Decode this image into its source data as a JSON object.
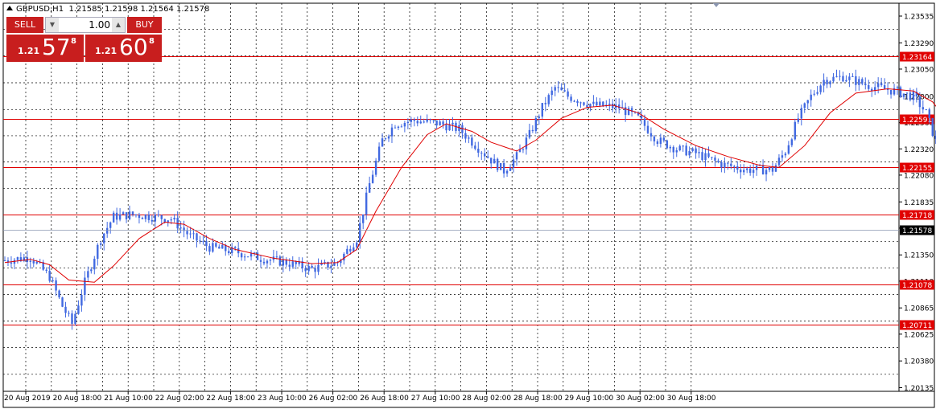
{
  "header": {
    "symbol": "GBPUSD,H1",
    "ohlc": "1.21585 1.21598 1.21564 1.21578"
  },
  "trade_panel": {
    "sell_label": "SELL",
    "buy_label": "BUY",
    "lot_value": "1.00",
    "sell_prefix": "1.21",
    "sell_big": "57",
    "sell_sup": "8",
    "buy_prefix": "1.21",
    "buy_big": "60",
    "buy_sup": "8"
  },
  "colors": {
    "background": "#ffffff",
    "candle": "#4169e1",
    "moving_average": "#e00000",
    "level_line": "#e00000",
    "level_label_bg": "#e00000",
    "current_price_bg": "#000000",
    "grid": "#000000",
    "panel_red": "#c81e1e"
  },
  "chart_data": {
    "type": "candlestick",
    "symbol": "GBPUSD",
    "timeframe": "H1",
    "y_axis": {
      "min": 1.20135,
      "max": 1.23535,
      "ticks": [
        "1.23535",
        "1.23290",
        "1.23050",
        "1.22800",
        "1.22560",
        "1.22320",
        "1.22080",
        "1.21835",
        "1.21595",
        "1.21350",
        "1.21110",
        "1.20865",
        "1.20625",
        "1.20380",
        "1.20135"
      ]
    },
    "x_axis": {
      "ticks": [
        "20 Aug 2019",
        "20 Aug 18:00",
        "21 Aug 10:00",
        "22 Aug 02:00",
        "22 Aug 18:00",
        "23 Aug 10:00",
        "26 Aug 02:00",
        "26 Aug 18:00",
        "27 Aug 10:00",
        "28 Aug 02:00",
        "28 Aug 18:00",
        "29 Aug 10:00",
        "30 Aug 02:00",
        "30 Aug 18:00"
      ]
    },
    "levels": [
      "1.23164",
      "1.22591",
      "1.22155",
      "1.21718",
      "1.21078",
      "1.20711"
    ],
    "current_price": "1.21578",
    "bars_per_grid": 16,
    "close_path": [
      [
        0,
        1.213
      ],
      [
        8,
        1.2133
      ],
      [
        14,
        1.2115
      ],
      [
        18,
        1.2088
      ],
      [
        21,
        1.2072
      ],
      [
        25,
        1.211
      ],
      [
        30,
        1.215
      ],
      [
        34,
        1.217
      ],
      [
        40,
        1.2172
      ],
      [
        46,
        1.217
      ],
      [
        52,
        1.2168
      ],
      [
        58,
        1.2152
      ],
      [
        64,
        1.2142
      ],
      [
        72,
        1.2138
      ],
      [
        80,
        1.2132
      ],
      [
        88,
        1.2128
      ],
      [
        96,
        1.2122
      ],
      [
        104,
        1.2128
      ],
      [
        110,
        1.215
      ],
      [
        114,
        1.22
      ],
      [
        118,
        1.224
      ],
      [
        122,
        1.2255
      ],
      [
        128,
        1.2258
      ],
      [
        136,
        1.2255
      ],
      [
        142,
        1.225
      ],
      [
        148,
        1.2233
      ],
      [
        152,
        1.2222
      ],
      [
        156,
        1.2212
      ],
      [
        160,
        1.2225
      ],
      [
        164,
        1.2245
      ],
      [
        168,
        1.227
      ],
      [
        172,
        1.2288
      ],
      [
        176,
        1.228
      ],
      [
        184,
        1.2272
      ],
      [
        192,
        1.227
      ],
      [
        198,
        1.226
      ],
      [
        204,
        1.224
      ],
      [
        210,
        1.2232
      ],
      [
        216,
        1.2228
      ],
      [
        224,
        1.2218
      ],
      [
        232,
        1.2213
      ],
      [
        240,
        1.2213
      ],
      [
        244,
        1.223
      ],
      [
        248,
        1.226
      ],
      [
        252,
        1.228
      ],
      [
        256,
        1.2295
      ],
      [
        262,
        1.2298
      ],
      [
        270,
        1.229
      ],
      [
        278,
        1.2285
      ],
      [
        284,
        1.228
      ],
      [
        288,
        1.2265
      ],
      [
        292,
        1.223
      ],
      [
        296,
        1.2212
      ],
      [
        300,
        1.2208
      ],
      [
        306,
        1.2228
      ],
      [
        312,
        1.2222
      ],
      [
        318,
        1.2218
      ],
      [
        324,
        1.221
      ],
      [
        332,
        1.2205
      ],
      [
        340,
        1.2198
      ],
      [
        348,
        1.2195
      ],
      [
        356,
        1.2188
      ],
      [
        364,
        1.2185
      ],
      [
        372,
        1.2182
      ],
      [
        380,
        1.218
      ],
      [
        384,
        1.2196
      ],
      [
        388,
        1.219
      ],
      [
        392,
        1.2178
      ],
      [
        398,
        1.2168
      ],
      [
        404,
        1.2163
      ],
      [
        410,
        1.216
      ],
      [
        414,
        1.21578
      ]
    ],
    "ma_path": [
      [
        0,
        1.2128
      ],
      [
        8,
        1.2131
      ],
      [
        14,
        1.2126
      ],
      [
        20,
        1.2112
      ],
      [
        28,
        1.211
      ],
      [
        34,
        1.2125
      ],
      [
        42,
        1.215
      ],
      [
        50,
        1.2165
      ],
      [
        56,
        1.2163
      ],
      [
        64,
        1.215
      ],
      [
        72,
        1.214
      ],
      [
        84,
        1.2132
      ],
      [
        96,
        1.2127
      ],
      [
        104,
        1.2128
      ],
      [
        110,
        1.214
      ],
      [
        116,
        1.2175
      ],
      [
        124,
        1.2215
      ],
      [
        132,
        1.2245
      ],
      [
        138,
        1.2255
      ],
      [
        146,
        1.2248
      ],
      [
        152,
        1.2238
      ],
      [
        160,
        1.223
      ],
      [
        166,
        1.224
      ],
      [
        174,
        1.226
      ],
      [
        182,
        1.227
      ],
      [
        190,
        1.2272
      ],
      [
        198,
        1.2265
      ],
      [
        206,
        1.225
      ],
      [
        216,
        1.2235
      ],
      [
        226,
        1.2225
      ],
      [
        236,
        1.2217
      ],
      [
        242,
        1.2215
      ],
      [
        250,
        1.2235
      ],
      [
        258,
        1.2265
      ],
      [
        266,
        1.2283
      ],
      [
        276,
        1.2287
      ],
      [
        284,
        1.2285
      ],
      [
        290,
        1.2275
      ],
      [
        298,
        1.2245
      ],
      [
        306,
        1.2228
      ],
      [
        314,
        1.2223
      ],
      [
        322,
        1.2218
      ],
      [
        332,
        1.221
      ],
      [
        342,
        1.2203
      ],
      [
        352,
        1.2195
      ],
      [
        362,
        1.219
      ],
      [
        372,
        1.2186
      ],
      [
        382,
        1.2182
      ],
      [
        392,
        1.2179
      ],
      [
        400,
        1.2174
      ],
      [
        408,
        1.2168
      ],
      [
        414,
        1.2162
      ]
    ]
  }
}
